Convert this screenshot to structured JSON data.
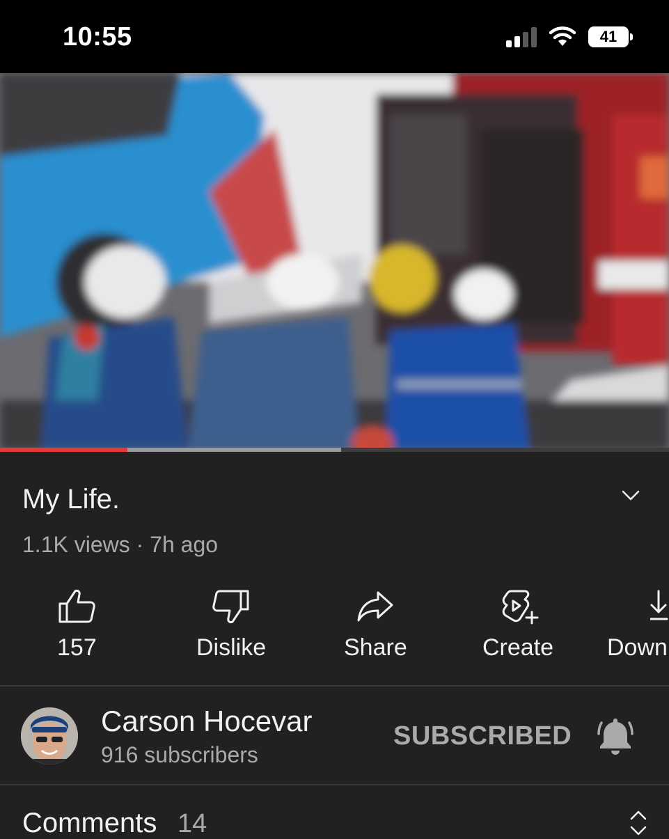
{
  "status_bar": {
    "time": "10:55",
    "battery": "41",
    "icons": [
      "signal-icon",
      "wifi-icon",
      "battery-icon"
    ]
  },
  "video": {
    "thumbnail": "video-frame",
    "played_fraction": 0.19,
    "buffered_fraction": 0.51,
    "colors": {
      "played": "#e53935",
      "buffered": "#9a9a9a",
      "track": "#3d3d3d"
    }
  },
  "info": {
    "title": "My Life.",
    "meta": "1.1K views · 7h ago"
  },
  "actions": [
    {
      "icon": "thumbs-up-icon",
      "label": "157"
    },
    {
      "icon": "thumbs-down-icon",
      "label": "Dislike"
    },
    {
      "icon": "share-icon",
      "label": "Share"
    },
    {
      "icon": "create-icon",
      "label": "Create"
    },
    {
      "icon": "download-icon",
      "label": "Down"
    }
  ],
  "channel": {
    "name": "Carson Hocevar",
    "subscribers": "916 subscribers",
    "subscribe_label": "SUBSCRIBED"
  },
  "comments": {
    "label": "Comments",
    "count": "14"
  }
}
